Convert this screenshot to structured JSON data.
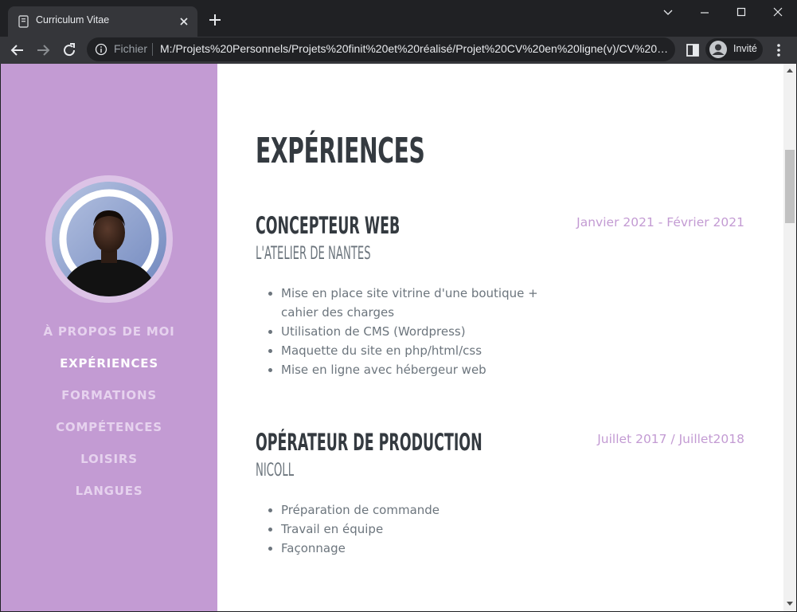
{
  "browser": {
    "tab_title": "Curriculum Vitae",
    "fichier_label": "Fichier",
    "url": "M:/Projets%20Personnels/Projets%20finit%20et%20réalisé/Projet%20CV%20en%20ligne(v)/CV%20en%20ligne(v)/index.html",
    "profile_label": "Invité"
  },
  "icons": {
    "favicon": "page-favicon-icon",
    "tab_close": "close-icon",
    "new_tab": "plus-icon",
    "back": "arrow-left-icon",
    "forward": "arrow-right-icon",
    "reload": "reload-icon",
    "site_info": "info-icon",
    "side_panel": "side-panel-icon",
    "profile": "avatar-icon",
    "menu": "kebab-menu-icon"
  },
  "colors": {
    "sidebar_bg": "#c39bd3",
    "nav_text": "#e6d2ee",
    "nav_active": "#ffffff",
    "heading": "#343a40",
    "subheading": "#6c757d",
    "date": "#c39bd3",
    "body_text": "#6c757d"
  },
  "nav": [
    {
      "label": "À PROPOS DE MOI",
      "active": false
    },
    {
      "label": "EXPÉRIENCES",
      "active": true
    },
    {
      "label": "FORMATIONS",
      "active": false
    },
    {
      "label": "COMPÉTENCES",
      "active": false
    },
    {
      "label": "LOISIRS",
      "active": false
    },
    {
      "label": "LANGUES",
      "active": false
    }
  ],
  "section": {
    "title": "EXPÉRIENCES"
  },
  "experiences": [
    {
      "title": "CONCEPTEUR WEB",
      "company": "L'ATELIER DE NANTES",
      "date": "Janvier 2021 - Février 2021",
      "bullets": [
        "Mise en place site vitrine d'une boutique + cahier des charges",
        "Utilisation de CMS (Wordpress)",
        "Maquette du site en php/html/css",
        "Mise en ligne avec hébergeur web"
      ]
    },
    {
      "title": "OPÉRATEUR DE PRODUCTION",
      "company": "NICOLL",
      "date": "Juillet 2017 / Juillet2018",
      "bullets": [
        "Préparation de commande",
        "Travail en équipe",
        "Façonnage"
      ]
    }
  ]
}
